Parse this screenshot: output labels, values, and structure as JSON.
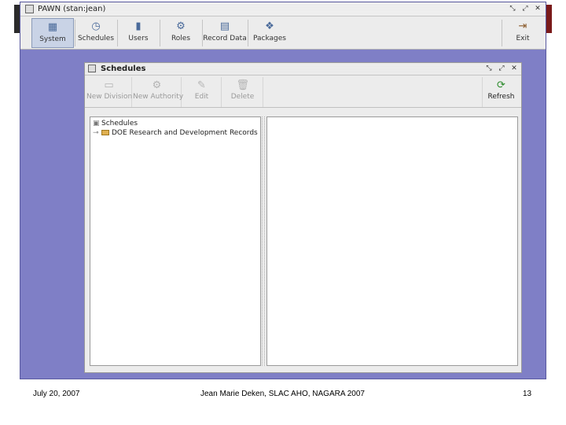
{
  "app": {
    "title": "PAWN (stan:jean)",
    "controls": {
      "restore": "⤡",
      "maximize": "⤢",
      "close": "✕"
    },
    "toolbar": [
      {
        "label": "System",
        "icon": "system-icon",
        "selected": true
      },
      {
        "label": "Schedules",
        "icon": "schedules-icon",
        "selected": false
      },
      {
        "label": "Users",
        "icon": "users-icon",
        "selected": false
      },
      {
        "label": "Roles",
        "icon": "roles-icon",
        "selected": false
      },
      {
        "label": "Record Data",
        "icon": "record-data-icon",
        "selected": false
      },
      {
        "label": "Packages",
        "icon": "packages-icon",
        "selected": false
      }
    ],
    "exit_label": "Exit"
  },
  "schedules_window": {
    "title": "Schedules",
    "toolbar": [
      {
        "label": "New Division",
        "icon": "new-division-icon",
        "enabled": false
      },
      {
        "label": "New Authority",
        "icon": "new-authority-icon",
        "enabled": false
      },
      {
        "label": "Edit",
        "icon": "edit-icon",
        "enabled": false
      },
      {
        "label": "Delete",
        "icon": "delete-icon",
        "enabled": false
      }
    ],
    "refresh_label": "Refresh",
    "tree": {
      "root": "Schedules",
      "children": [
        "DOE Research and Development Records"
      ]
    }
  },
  "footer": {
    "date": "July 20, 2007",
    "presenter": "Jean Marie Deken, SLAC AHO, NAGARA 2007",
    "page": "13"
  }
}
